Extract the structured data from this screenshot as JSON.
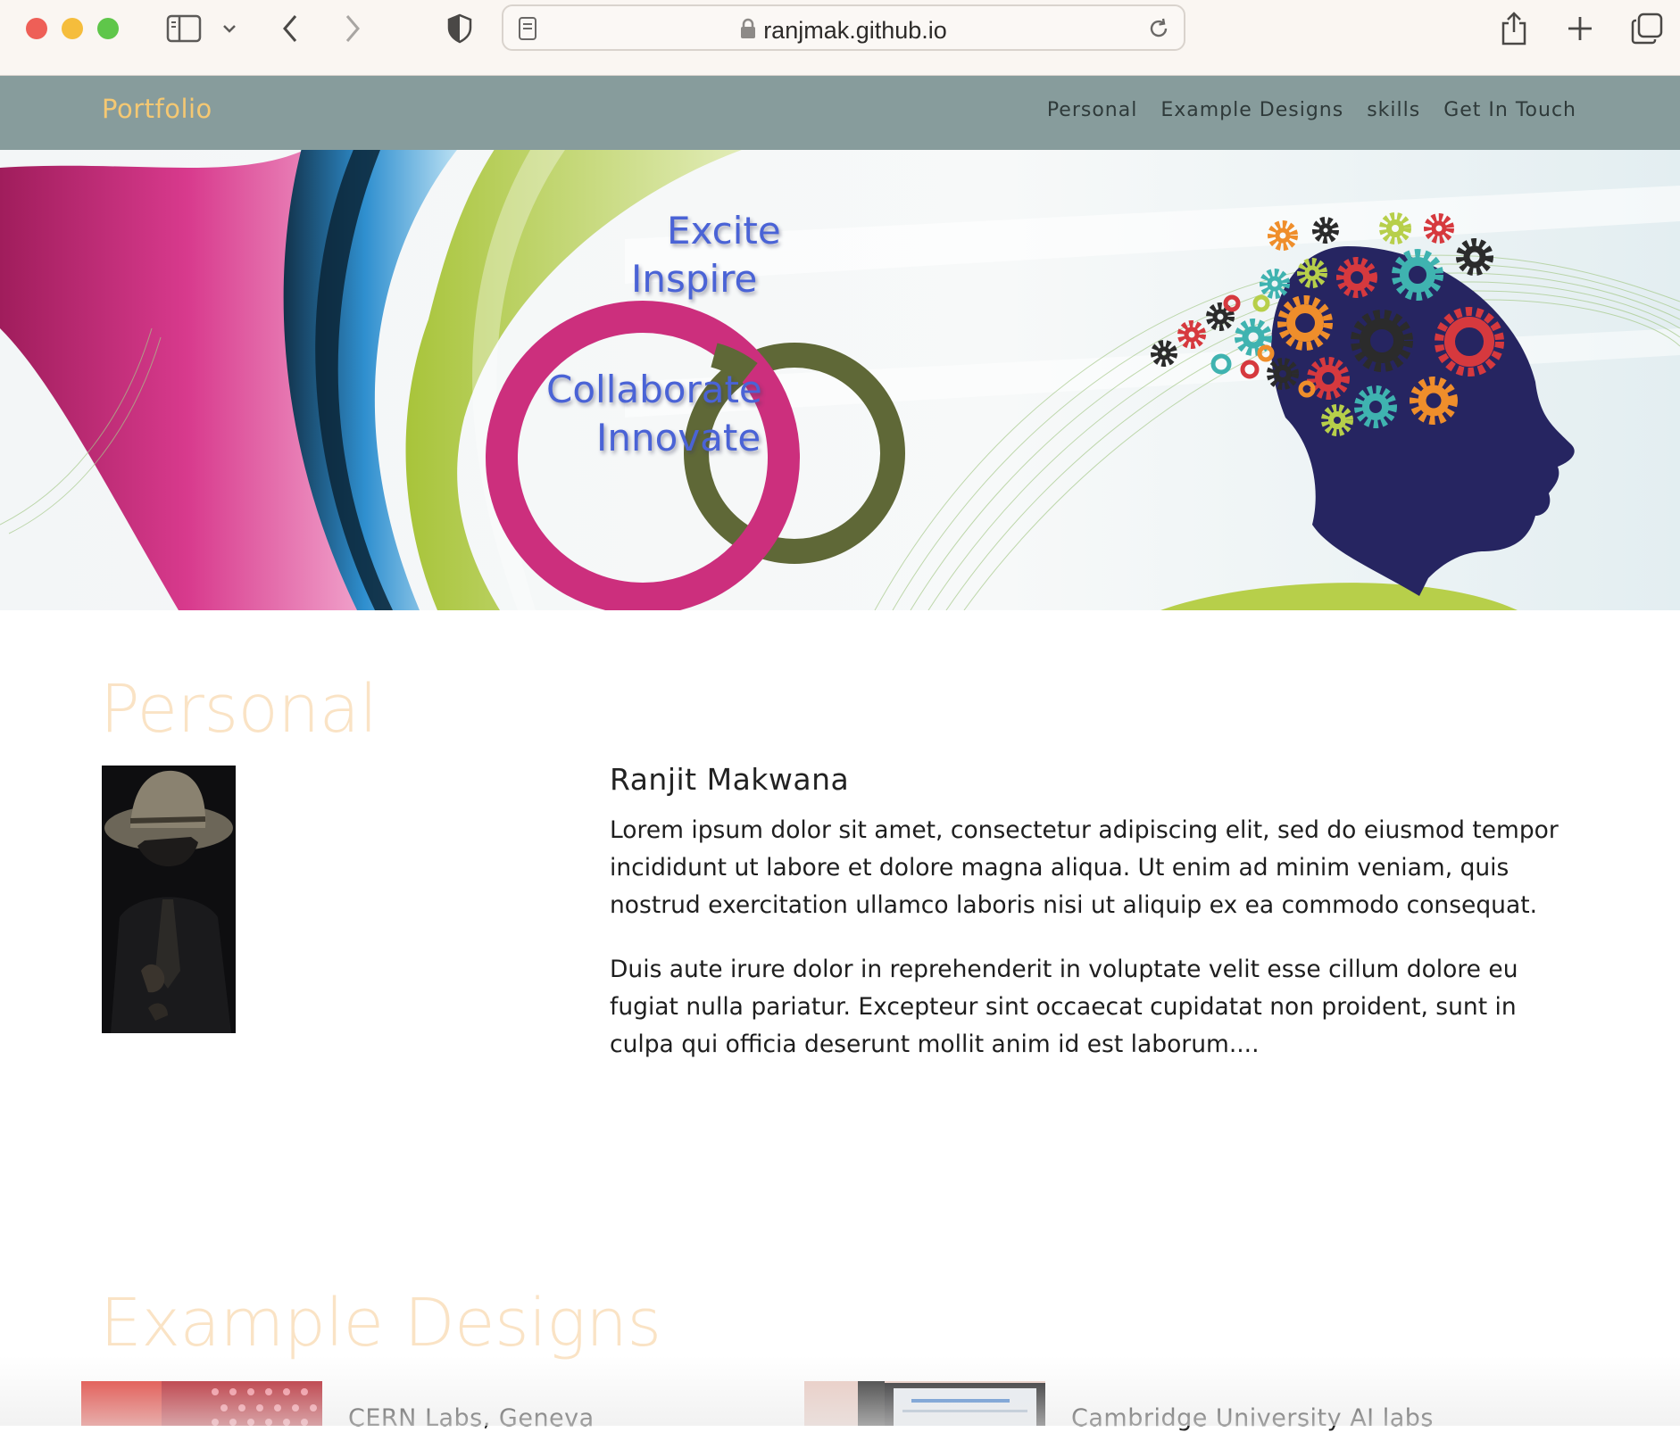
{
  "browser": {
    "url": "ranjmak.github.io"
  },
  "navbar": {
    "brand": "Portfolio",
    "links": [
      "Personal",
      "Example Designs",
      "skills",
      "Get In Touch"
    ]
  },
  "hero": {
    "words": [
      "Excite",
      "Inspire",
      "Collaborate",
      "Innovate"
    ]
  },
  "personal": {
    "heading": "Personal",
    "name": "Ranjit Makwana",
    "paragraph_1": "Lorem ipsum dolor sit amet, consectetur adipiscing elit, sed do eiusmod tempor incididunt ut labore et dolore magna aliqua. Ut enim ad minim veniam, quis nostrud exercitation ullamco laboris nisi ut aliquip ex ea commodo consequat.",
    "paragraph_2": "Duis aute irure dolor in reprehenderit in voluptate velit esse cillum dolore eu fugiat nulla pariatur. Excepteur sint occaecat cupidatat non proident, sunt in culpa qui officia deserunt mollit anim id est laborum...."
  },
  "designs": {
    "heading": "Example Designs",
    "cards": [
      {
        "title": "CERN Labs, Geneva"
      },
      {
        "title": "Cambridge University AI labs"
      }
    ]
  },
  "colors": {
    "navbar_bg": "#879c9c",
    "brand": "#f5c872",
    "section_heading": "#fae3c5",
    "hero_text": "#4a63d6"
  }
}
